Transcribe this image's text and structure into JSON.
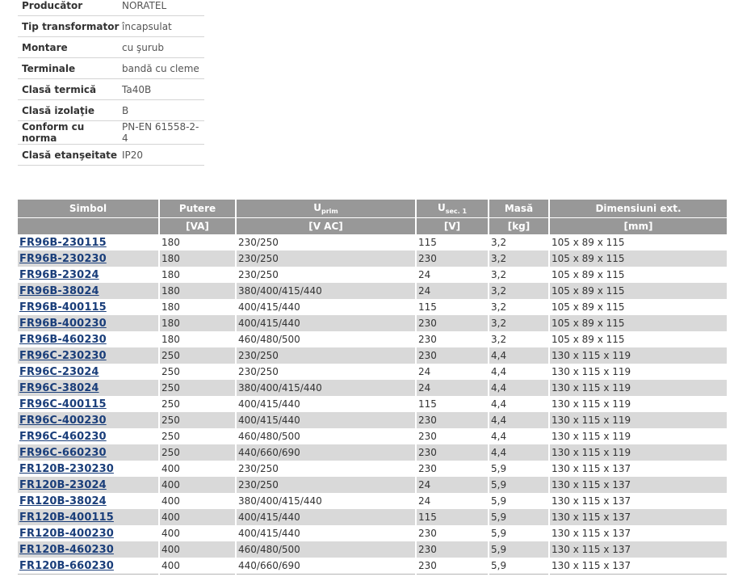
{
  "specs": [
    {
      "label": "Producător",
      "value": "NORATEL"
    },
    {
      "label": "Tip transformator",
      "value": "încapsulat"
    },
    {
      "label": "Montare",
      "value": "cu şurub"
    },
    {
      "label": "Terminale",
      "value": "bandă cu cleme"
    },
    {
      "label": "Clasă termică",
      "value": "Ta40B"
    },
    {
      "label": "Clasă izolaţie",
      "value": "B"
    },
    {
      "label": "Conform cu norma",
      "value": "PN-EN 61558-2-4"
    },
    {
      "label": "Clasă etanşeitate",
      "value": "IP20"
    }
  ],
  "table": {
    "headers": {
      "symbol": "Simbol",
      "power": "Putere",
      "uprim_main": "U",
      "uprim_sub": "prim",
      "usec_main": "U",
      "usec_sub": "sec. 1",
      "mass": "Masă",
      "dims": "Dimensiuni ext."
    },
    "units": {
      "symbol": "",
      "power": "[VA]",
      "uprim": "[V AC]",
      "usec": "[V]",
      "mass": "[kg]",
      "dims": "[mm]"
    },
    "rows": [
      [
        "FR96B-230115",
        "180",
        "230/250",
        "115",
        "3,2",
        "105 x 89 x 115"
      ],
      [
        "FR96B-230230",
        "180",
        "230/250",
        "230",
        "3,2",
        "105 x 89 x 115"
      ],
      [
        "FR96B-23024",
        "180",
        "230/250",
        "24",
        "3,2",
        "105 x 89 x 115"
      ],
      [
        "FR96B-38024",
        "180",
        "380/400/415/440",
        "24",
        "3,2",
        "105 x 89 x 115"
      ],
      [
        "FR96B-400115",
        "180",
        "400/415/440",
        "115",
        "3,2",
        "105 x 89 x 115"
      ],
      [
        "FR96B-400230",
        "180",
        "400/415/440",
        "230",
        "3,2",
        "105 x 89 x 115"
      ],
      [
        "FR96B-460230",
        "180",
        "460/480/500",
        "230",
        "3,2",
        "105 x 89 x 115"
      ],
      [
        "FR96C-230230",
        "250",
        "230/250",
        "230",
        "4,4",
        "130 x 115 x 119"
      ],
      [
        "FR96C-23024",
        "250",
        "230/250",
        "24",
        "4,4",
        "130 x 115 x 119"
      ],
      [
        "FR96C-38024",
        "250",
        "380/400/415/440",
        "24",
        "4,4",
        "130 x 115 x 119"
      ],
      [
        "FR96C-400115",
        "250",
        "400/415/440",
        "115",
        "4,4",
        "130 x 115 x 119"
      ],
      [
        "FR96C-400230",
        "250",
        "400/415/440",
        "230",
        "4,4",
        "130 x 115 x 119"
      ],
      [
        "FR96C-460230",
        "250",
        "460/480/500",
        "230",
        "4,4",
        "130 x 115 x 119"
      ],
      [
        "FR96C-660230",
        "250",
        "440/660/690",
        "230",
        "4,4",
        "130 x 115 x 119"
      ],
      [
        "FR120B-230230",
        "400",
        "230/250",
        "230",
        "5,9",
        "130 x 115 x 137"
      ],
      [
        "FR120B-23024",
        "400",
        "230/250",
        "24",
        "5,9",
        "130 x 115 x 137"
      ],
      [
        "FR120B-38024",
        "400",
        "380/400/415/440",
        "24",
        "5,9",
        "130 x 115 x 137"
      ],
      [
        "FR120B-400115",
        "400",
        "400/415/440",
        "115",
        "5,9",
        "130 x 115 x 137"
      ],
      [
        "FR120B-400230",
        "400",
        "400/415/440",
        "230",
        "5,9",
        "130 x 115 x 137"
      ],
      [
        "FR120B-460230",
        "400",
        "460/480/500",
        "230",
        "5,9",
        "130 x 115 x 137"
      ],
      [
        "FR120B-660230",
        "400",
        "440/660/690",
        "230",
        "5,9",
        "130 x 115 x 137"
      ]
    ]
  }
}
